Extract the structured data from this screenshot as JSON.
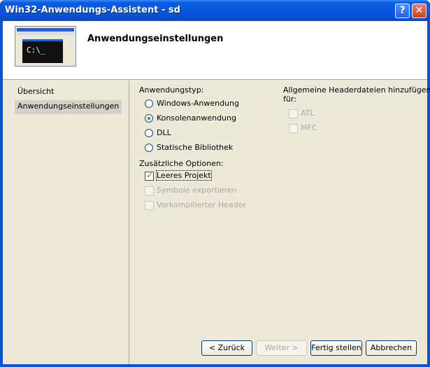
{
  "window": {
    "title": "Win32-Anwendungs-Assistent - sd"
  },
  "titlebar": {
    "help_glyph": "?",
    "close_glyph": "✕"
  },
  "header": {
    "title": "Anwendungseinstellungen",
    "thumb_prompt": "C:\\_"
  },
  "sidebar": {
    "items": [
      {
        "label": "Übersicht",
        "selected": false
      },
      {
        "label": "Anwendungseinstellungen",
        "selected": true
      }
    ]
  },
  "app_type": {
    "label": "Anwendungstyp:",
    "options": [
      {
        "label": "Windows-Anwendung",
        "checked": false
      },
      {
        "label": "Konsolenanwendung",
        "checked": true
      },
      {
        "label": "DLL",
        "checked": false
      },
      {
        "label": "Statische Bibliothek",
        "checked": false
      }
    ]
  },
  "extra_options": {
    "label": "Zusätzliche Optionen:",
    "items": [
      {
        "label": "Leeres Projekt",
        "checked": true,
        "enabled": true
      },
      {
        "label": "Symbole exportieren",
        "checked": false,
        "enabled": false
      },
      {
        "label": "Vorkompilierter Header",
        "checked": false,
        "enabled": false
      }
    ]
  },
  "headers": {
    "label_line1": "Allgemeine Headerdateien hinzufügen",
    "label_line2": "für:",
    "items": [
      {
        "label": "ATL",
        "checked": false,
        "enabled": false
      },
      {
        "label": "MFC",
        "checked": false,
        "enabled": false
      }
    ]
  },
  "buttons": {
    "back": "< Zurück",
    "next": "Weiter >",
    "finish": "Fertig stellen",
    "cancel": "Abbrechen"
  },
  "colors": {
    "titlebar": "#0754d9",
    "dialog_bg": "#ece9d8",
    "check_green": "#21a121"
  }
}
